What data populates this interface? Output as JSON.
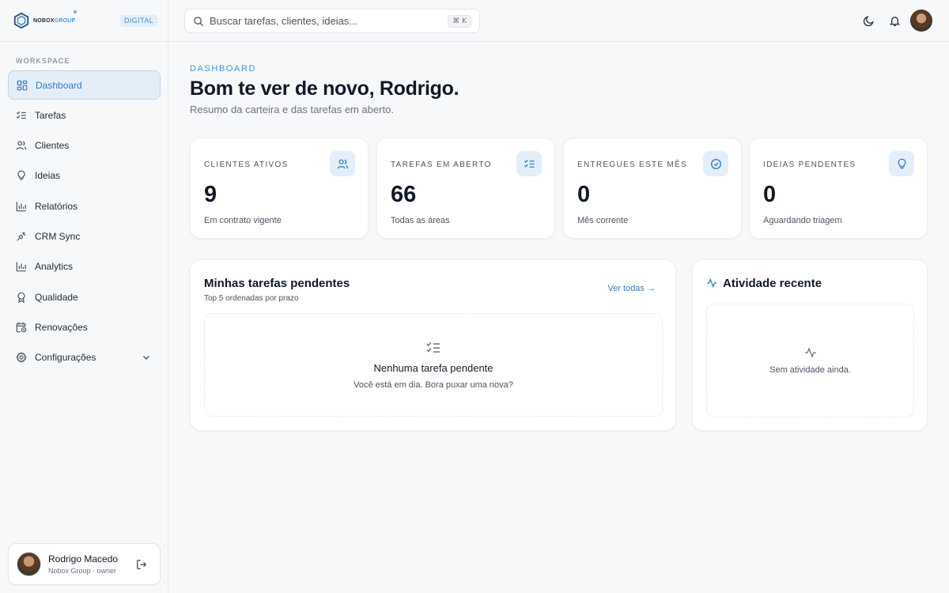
{
  "brand": {
    "name_part1": "NOBOX",
    "name_part2": "GROUP",
    "badge": "DIGITAL"
  },
  "sidebar": {
    "section_label": "WORKSPACE",
    "items": [
      {
        "label": "Dashboard",
        "icon": "dashboard-grid-icon",
        "active": true
      },
      {
        "label": "Tarefas",
        "icon": "checklist-icon"
      },
      {
        "label": "Clientes",
        "icon": "users-icon"
      },
      {
        "label": "Ideias",
        "icon": "lightbulb-icon"
      },
      {
        "label": "Relatórios",
        "icon": "bar-chart-icon"
      },
      {
        "label": "CRM Sync",
        "icon": "plug-icon"
      },
      {
        "label": "Analytics",
        "icon": "bar-chart-icon"
      },
      {
        "label": "Qualidade",
        "icon": "award-icon"
      },
      {
        "label": "Renovações",
        "icon": "calendar-clock-icon"
      },
      {
        "label": "Configurações",
        "icon": "gear-icon",
        "expandable": true
      }
    ]
  },
  "user": {
    "name": "Rodrigo Macedo",
    "role": "Nobox Group · owner"
  },
  "topbar": {
    "search_placeholder": "Buscar tarefas, clientes, ideias...",
    "shortcut": "⌘ K"
  },
  "header": {
    "eyebrow": "DASHBOARD",
    "title": "Bom te ver de novo, Rodrigo.",
    "subtitle": "Resumo da carteira e das tarefas em aberto."
  },
  "stats": [
    {
      "label": "CLIENTES ATIVOS",
      "value": "9",
      "foot": "Em contrato vigente",
      "icon": "users-icon"
    },
    {
      "label": "TAREFAS EM ABERTO",
      "value": "66",
      "foot": "Todas as áreas",
      "icon": "checklist-icon"
    },
    {
      "label": "ENTREGUES ESTE MÊS",
      "value": "0",
      "foot": "Mês corrente",
      "icon": "check-circle-icon"
    },
    {
      "label": "IDEIAS PENDENTES",
      "value": "0",
      "foot": "Aguardando triagem",
      "icon": "lightbulb-icon"
    }
  ],
  "tasks_panel": {
    "title": "Minhas tarefas pendentes",
    "subtitle": "Top 5 ordenadas por prazo",
    "link": "Ver todas →",
    "empty_title": "Nenhuma tarefa pendente",
    "empty_sub": "Você está em dia. Bora puxar uma nova?"
  },
  "activity_panel": {
    "title": "Atividade recente",
    "empty": "Sem atividade ainda."
  },
  "colors": {
    "accent": "#2f7fc1",
    "accent_bg": "#e4eef9",
    "eyebrow": "#3b9ad9"
  }
}
